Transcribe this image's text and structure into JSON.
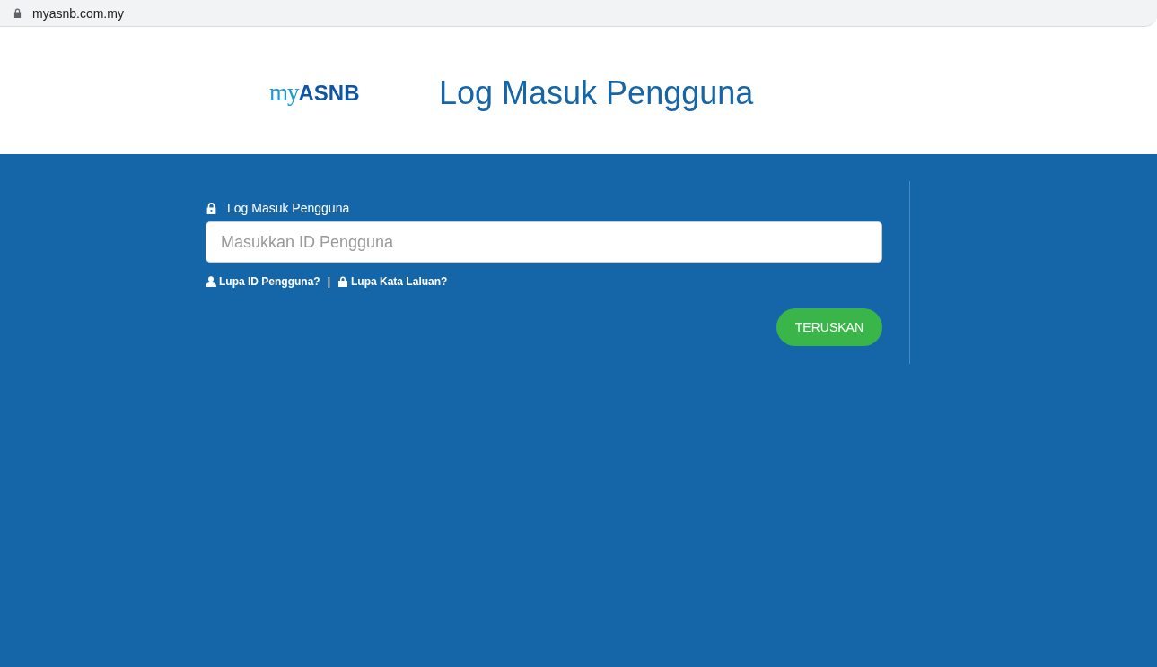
{
  "address_bar": {
    "url": "myasnb.com.my"
  },
  "header": {
    "logo": "my**ASNB**",
    "title": "Log Masuk Pengguna"
  },
  "login": {
    "label": "Log Masuk Pengguna",
    "placeholder": "Masukkan ID Pengguna",
    "links": [
      {
        "kind": "user",
        "label": "Lupa ID Pengguna?"
      },
      {
        "kind": "lock",
        "label": "Lupa Kata Laluan?"
      }
    ],
    "separator": "|",
    "button": "TERUSKAN"
  }
}
